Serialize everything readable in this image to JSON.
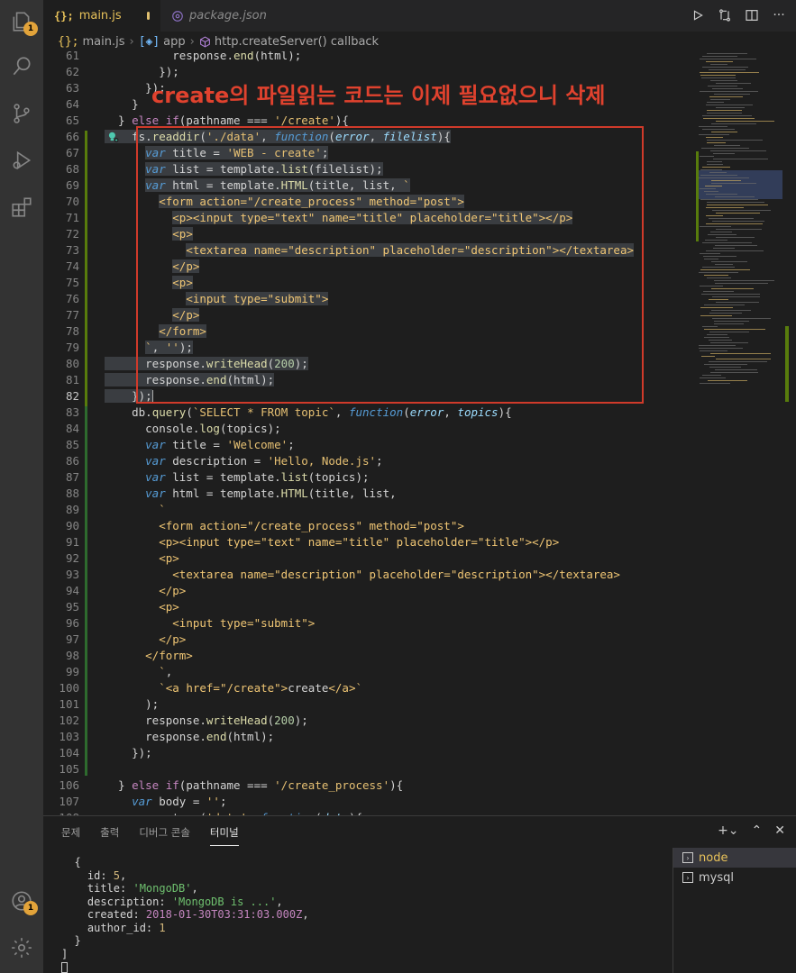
{
  "tabs": [
    {
      "glyph": "{};",
      "label": "main.js",
      "modified": true
    },
    {
      "glyph": "{}",
      "label": "package.json",
      "modified": false
    }
  ],
  "breadcrumb": {
    "file": "main.js",
    "symbol1": "app",
    "symbol2": "http.createServer() callback"
  },
  "annotation": {
    "text": "create의 파일읽는 코드는 이제 필요없으니 삭제",
    "color": "#e0422e"
  },
  "activity": {
    "explorer_badge": "1",
    "account_badge": "1"
  },
  "editor": {
    "current_line": 82,
    "lines": [
      {
        "n": 61,
        "t": [
          [
            "plain",
            "          response."
          ],
          [
            "fn",
            "end"
          ],
          [
            "plain",
            "(html);"
          ]
        ]
      },
      {
        "n": 62,
        "t": [
          [
            "plain",
            "        });"
          ]
        ]
      },
      {
        "n": 63,
        "t": [
          [
            "plain",
            "      });"
          ]
        ]
      },
      {
        "n": 64,
        "t": [
          [
            "plain",
            "    }"
          ]
        ]
      },
      {
        "n": 65,
        "t": [
          [
            "plain",
            "  } "
          ],
          [
            "kw",
            "else if"
          ],
          [
            "plain",
            "(pathname === "
          ],
          [
            "str",
            "'/create'"
          ],
          [
            "plain",
            "){"
          ]
        ]
      },
      {
        "n": 66,
        "sel": true,
        "t": [
          [
            "plain",
            "    fs."
          ],
          [
            "fn",
            "readdir"
          ],
          [
            "plain",
            "("
          ],
          [
            "str",
            "'./data'"
          ],
          [
            "plain",
            ", "
          ],
          [
            "var",
            "function"
          ],
          [
            "plain",
            "("
          ],
          [
            "prm",
            "error"
          ],
          [
            "plain",
            ", "
          ],
          [
            "prm",
            "filelist"
          ],
          [
            "plain",
            "){"
          ]
        ]
      },
      {
        "n": 67,
        "sel": true,
        "t": [
          [
            "plain",
            "      "
          ],
          [
            "var",
            "var"
          ],
          [
            "plain",
            " title = "
          ],
          [
            "str",
            "'WEB - create'"
          ],
          [
            "plain",
            ";"
          ]
        ]
      },
      {
        "n": 68,
        "sel": true,
        "t": [
          [
            "plain",
            "      "
          ],
          [
            "var",
            "var"
          ],
          [
            "plain",
            " list = template."
          ],
          [
            "fn",
            "list"
          ],
          [
            "plain",
            "(filelist);"
          ]
        ]
      },
      {
        "n": 69,
        "sel": true,
        "t": [
          [
            "plain",
            "      "
          ],
          [
            "var",
            "var"
          ],
          [
            "plain",
            " html = template."
          ],
          [
            "fn",
            "HTML"
          ],
          [
            "plain",
            "(title, list, "
          ],
          [
            "str",
            "`"
          ]
        ]
      },
      {
        "n": 70,
        "sel": true,
        "t": [
          [
            "plain",
            "        "
          ],
          [
            "tag",
            "<form action=\"/create_process\" method=\"post\">"
          ]
        ]
      },
      {
        "n": 71,
        "sel": true,
        "t": [
          [
            "plain",
            "          "
          ],
          [
            "tag",
            "<p><input type=\"text\" name=\"title\" placeholder=\"title\"></p>"
          ]
        ]
      },
      {
        "n": 72,
        "sel": true,
        "t": [
          [
            "plain",
            "          "
          ],
          [
            "tag",
            "<p>"
          ]
        ]
      },
      {
        "n": 73,
        "sel": true,
        "t": [
          [
            "plain",
            "            "
          ],
          [
            "tag",
            "<textarea name=\"description\" placeholder=\"description\"></textarea>"
          ]
        ]
      },
      {
        "n": 74,
        "sel": true,
        "t": [
          [
            "plain",
            "          "
          ],
          [
            "tag",
            "</p>"
          ]
        ]
      },
      {
        "n": 75,
        "sel": true,
        "t": [
          [
            "plain",
            "          "
          ],
          [
            "tag",
            "<p>"
          ]
        ]
      },
      {
        "n": 76,
        "sel": true,
        "t": [
          [
            "plain",
            "            "
          ],
          [
            "tag",
            "<input type=\"submit\">"
          ]
        ]
      },
      {
        "n": 77,
        "sel": true,
        "t": [
          [
            "plain",
            "          "
          ],
          [
            "tag",
            "</p>"
          ]
        ]
      },
      {
        "n": 78,
        "sel": true,
        "t": [
          [
            "plain",
            "        "
          ],
          [
            "tag",
            "</form>"
          ]
        ]
      },
      {
        "n": 79,
        "sel": true,
        "t": [
          [
            "plain",
            "      "
          ],
          [
            "str",
            "`"
          ],
          [
            "plain",
            ", "
          ],
          [
            "str",
            "''"
          ],
          [
            "plain",
            ");"
          ]
        ]
      },
      {
        "n": 80,
        "sel": true,
        "t": [
          [
            "plain",
            "      response."
          ],
          [
            "fn",
            "writeHead"
          ],
          [
            "plain",
            "("
          ],
          [
            "num",
            "200"
          ],
          [
            "plain",
            ");"
          ]
        ]
      },
      {
        "n": 81,
        "sel": true,
        "t": [
          [
            "plain",
            "      response."
          ],
          [
            "fn",
            "end"
          ],
          [
            "plain",
            "(html);"
          ]
        ]
      },
      {
        "n": 82,
        "sel": true,
        "t": [
          [
            "plain",
            "    });"
          ]
        ]
      },
      {
        "n": 83,
        "t": [
          [
            "plain",
            "    db."
          ],
          [
            "fn",
            "query"
          ],
          [
            "plain",
            "("
          ],
          [
            "str",
            "`SELECT * FROM topic`"
          ],
          [
            "plain",
            ", "
          ],
          [
            "var",
            "function"
          ],
          [
            "plain",
            "("
          ],
          [
            "prm",
            "error"
          ],
          [
            "plain",
            ", "
          ],
          [
            "prm",
            "topics"
          ],
          [
            "plain",
            "){"
          ]
        ]
      },
      {
        "n": 84,
        "t": [
          [
            "plain",
            "      console."
          ],
          [
            "fn",
            "log"
          ],
          [
            "plain",
            "(topics);"
          ]
        ]
      },
      {
        "n": 85,
        "t": [
          [
            "plain",
            "      "
          ],
          [
            "var",
            "var"
          ],
          [
            "plain",
            " title = "
          ],
          [
            "str",
            "'Welcome'"
          ],
          [
            "plain",
            ";"
          ]
        ]
      },
      {
        "n": 86,
        "t": [
          [
            "plain",
            "      "
          ],
          [
            "var",
            "var"
          ],
          [
            "plain",
            " description = "
          ],
          [
            "str",
            "'Hello, Node.js'"
          ],
          [
            "plain",
            ";"
          ]
        ]
      },
      {
        "n": 87,
        "t": [
          [
            "plain",
            "      "
          ],
          [
            "var",
            "var"
          ],
          [
            "plain",
            " list = template."
          ],
          [
            "fn",
            "list"
          ],
          [
            "plain",
            "(topics);"
          ]
        ]
      },
      {
        "n": 88,
        "t": [
          [
            "plain",
            "      "
          ],
          [
            "var",
            "var"
          ],
          [
            "plain",
            " html = template."
          ],
          [
            "fn",
            "HTML"
          ],
          [
            "plain",
            "(title, list,"
          ]
        ]
      },
      {
        "n": 89,
        "t": [
          [
            "plain",
            "        "
          ],
          [
            "str",
            "`"
          ]
        ]
      },
      {
        "n": 90,
        "t": [
          [
            "plain",
            "        "
          ],
          [
            "tag",
            "<form action=\"/create_process\" method=\"post\">"
          ]
        ]
      },
      {
        "n": 91,
        "t": [
          [
            "plain",
            "        "
          ],
          [
            "tag",
            "<p><input type=\"text\" name=\"title\" placeholder=\"title\"></p>"
          ]
        ]
      },
      {
        "n": 92,
        "t": [
          [
            "plain",
            "        "
          ],
          [
            "tag",
            "<p>"
          ]
        ]
      },
      {
        "n": 93,
        "t": [
          [
            "plain",
            "          "
          ],
          [
            "tag",
            "<textarea name=\"description\" placeholder=\"description\"></textarea>"
          ]
        ]
      },
      {
        "n": 94,
        "t": [
          [
            "plain",
            "        "
          ],
          [
            "tag",
            "</p>"
          ]
        ]
      },
      {
        "n": 95,
        "t": [
          [
            "plain",
            "        "
          ],
          [
            "tag",
            "<p>"
          ]
        ]
      },
      {
        "n": 96,
        "t": [
          [
            "plain",
            "          "
          ],
          [
            "tag",
            "<input type=\"submit\">"
          ]
        ]
      },
      {
        "n": 97,
        "t": [
          [
            "plain",
            "        "
          ],
          [
            "tag",
            "</p>"
          ]
        ]
      },
      {
        "n": 98,
        "t": [
          [
            "plain",
            "      "
          ],
          [
            "tag",
            "</form>"
          ]
        ]
      },
      {
        "n": 99,
        "t": [
          [
            "plain",
            "        "
          ],
          [
            "str",
            "`"
          ],
          [
            "plain",
            ","
          ]
        ]
      },
      {
        "n": 100,
        "t": [
          [
            "plain",
            "        "
          ],
          [
            "str",
            "`"
          ],
          [
            "tag",
            "<a href=\"/create\">"
          ],
          [
            "plain",
            "create"
          ],
          [
            "tag",
            "</a>"
          ],
          [
            "str",
            "`"
          ]
        ]
      },
      {
        "n": 101,
        "t": [
          [
            "plain",
            "      );"
          ]
        ]
      },
      {
        "n": 102,
        "t": [
          [
            "plain",
            "      response."
          ],
          [
            "fn",
            "writeHead"
          ],
          [
            "plain",
            "("
          ],
          [
            "num",
            "200"
          ],
          [
            "plain",
            ");"
          ]
        ]
      },
      {
        "n": 103,
        "t": [
          [
            "plain",
            "      response."
          ],
          [
            "fn",
            "end"
          ],
          [
            "plain",
            "(html);"
          ]
        ]
      },
      {
        "n": 104,
        "t": [
          [
            "plain",
            "    });"
          ]
        ]
      },
      {
        "n": 105,
        "t": [
          [
            "plain",
            ""
          ]
        ]
      },
      {
        "n": 106,
        "t": [
          [
            "plain",
            "  } "
          ],
          [
            "kw",
            "else if"
          ],
          [
            "plain",
            "(pathname === "
          ],
          [
            "str",
            "'/create_process'"
          ],
          [
            "plain",
            "){"
          ]
        ]
      },
      {
        "n": 107,
        "t": [
          [
            "plain",
            "    "
          ],
          [
            "var",
            "var"
          ],
          [
            "plain",
            " body = "
          ],
          [
            "str",
            "''"
          ],
          [
            "plain",
            ";"
          ]
        ]
      },
      {
        "n": 108,
        "t": [
          [
            "plain",
            "    request."
          ],
          [
            "fn",
            "on"
          ],
          [
            "plain",
            "("
          ],
          [
            "str",
            "'data'"
          ],
          [
            "plain",
            ", "
          ],
          [
            "var",
            "function"
          ],
          [
            "plain",
            "("
          ],
          [
            "prm",
            "data"
          ],
          [
            "plain",
            "){"
          ]
        ]
      }
    ]
  },
  "panel": {
    "tabs": [
      "문제",
      "출력",
      "디버그 콘솔",
      "터미널"
    ],
    "active_tab": "터미널",
    "terminal_lines": [
      [
        [
          "plain",
          "  {"
        ]
      ],
      [
        [
          "plain",
          "    id: "
        ],
        [
          "num",
          "5"
        ],
        [
          "plain",
          ","
        ]
      ],
      [
        [
          "plain",
          "    title: "
        ],
        [
          "str",
          "'MongoDB'"
        ],
        [
          "plain",
          ","
        ]
      ],
      [
        [
          "plain",
          "    description: "
        ],
        [
          "str",
          "'MongoDB is ...'"
        ],
        [
          "plain",
          ","
        ]
      ],
      [
        [
          "plain",
          "    created: "
        ],
        [
          "date",
          "2018-01-30T03:31:03.000Z"
        ],
        [
          "plain",
          ","
        ]
      ],
      [
        [
          "plain",
          "    author_id: "
        ],
        [
          "num",
          "1"
        ]
      ],
      [
        [
          "plain",
          "  }"
        ]
      ],
      [
        [
          "plain",
          "]"
        ]
      ]
    ],
    "terminals": [
      {
        "label": "node",
        "active": true
      },
      {
        "label": "mysql",
        "active": false
      }
    ]
  }
}
